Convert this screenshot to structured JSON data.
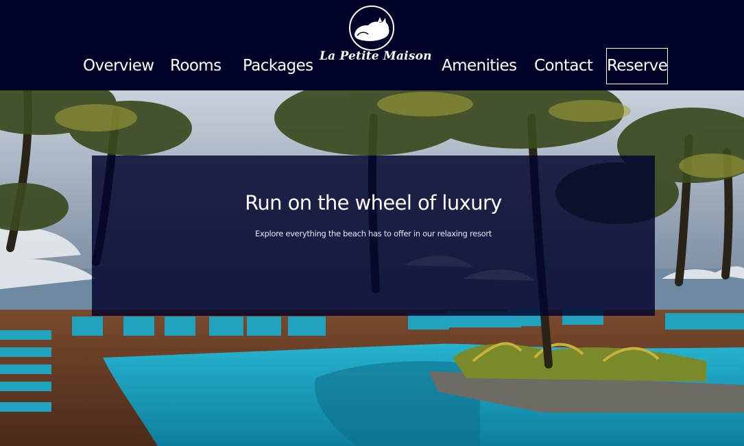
{
  "header": {
    "nav": {
      "overview": "Overview",
      "rooms": "Rooms",
      "packages": "Packages",
      "amenities": "Amenities",
      "contact": "Contact",
      "reserve": "Reserve"
    },
    "logo": {
      "text": "La Petite Maison",
      "icon": "sleeping-cat-icon"
    }
  },
  "hero": {
    "title": "Run on the wheel of luxury",
    "subtitle": "Explore everything the beach has to offer in our relaxing resort",
    "image": "resort-pool-palm-trees-photo"
  },
  "colors": {
    "header_bg": "#010428",
    "overlay": "#02052d",
    "text": "#ffffff",
    "pool": "#1fa8c9"
  }
}
